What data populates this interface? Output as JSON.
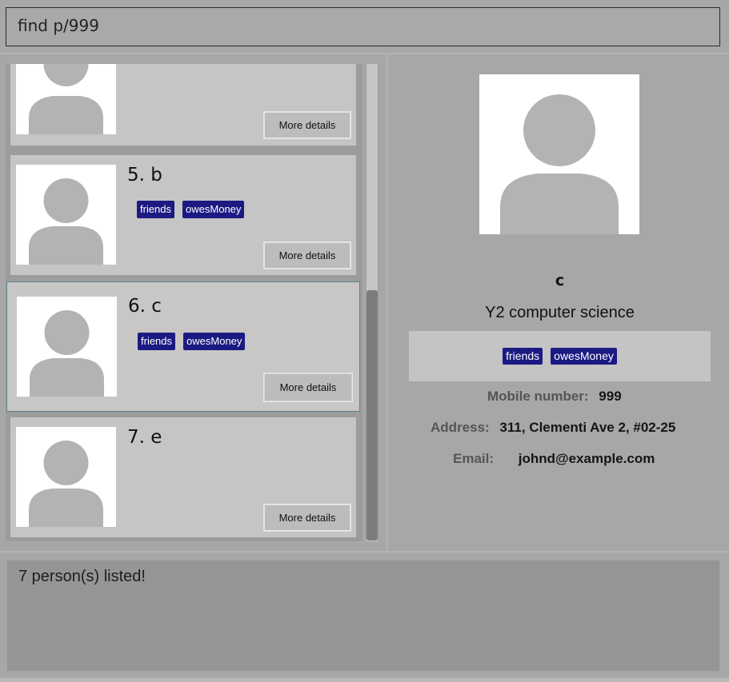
{
  "command": {
    "value": "find p/999"
  },
  "list": {
    "cards": [
      {
        "name": "",
        "tags": [],
        "button": "More details"
      },
      {
        "name": "5. b",
        "tags": [
          "friends",
          "owesMoney"
        ],
        "button": "More details"
      },
      {
        "name": "6. c",
        "tags": [
          "friends",
          "owesMoney"
        ],
        "button": "More details"
      },
      {
        "name": "7. e",
        "tags": [],
        "button": "More details"
      }
    ]
  },
  "detail": {
    "name": "c",
    "subtitle": "Y2 computer science",
    "tags": [
      "friends",
      "owesMoney"
    ],
    "mobile_label": "Mobile number:",
    "mobile_value": "999",
    "address_label": "Address:",
    "address_value": "311, Clementi Ave 2, #02-25",
    "email_label": "Email:",
    "email_value": "johnd@example.com"
  },
  "result": {
    "message": "7 person(s) listed!"
  },
  "colors": {
    "tag_bg": "#1b1a83",
    "avatar_fg": "#b3b3b3"
  },
  "icons": {
    "avatar": "default-person-avatar-icon"
  }
}
